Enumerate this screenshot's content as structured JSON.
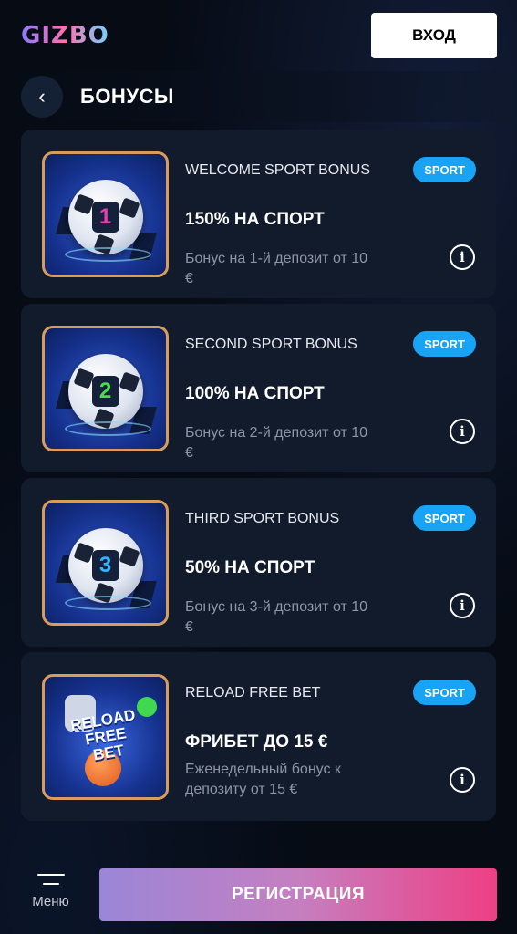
{
  "header": {
    "logo": "GIZBO",
    "login_label": "ВХОД"
  },
  "titlebar": {
    "back_icon": "chevron-left-icon",
    "title": "БОНУСЫ"
  },
  "bonuses": [
    {
      "name": "WELCOME SPORT BONUS",
      "badge": "SPORT",
      "headline": "150% НА СПОРТ",
      "description": "Бонус на 1-й депозит от 10 €",
      "ball_number": "1",
      "number_color": "#e83fb0"
    },
    {
      "name": "SECOND SPORT BONUS",
      "badge": "SPORT",
      "headline": "100% НА СПОРТ",
      "description": "Бонус на 2-й депозит от 10 €",
      "ball_number": "2",
      "number_color": "#44e04a"
    },
    {
      "name": "THIRD SPORT BONUS",
      "badge": "SPORT",
      "headline": "50% НА СПОРТ",
      "description": "Бонус на 3-й депозит от 10 €",
      "ball_number": "3",
      "number_color": "#31b6ff"
    },
    {
      "name": "RELOAD FREE BET",
      "badge": "SPORT",
      "headline": "ФРИБЕТ ДО 15 €",
      "description": "Еженедельный бонус к депозиту от 15 €",
      "art_text_line1": "RELOAD",
      "art_text_line2": "FREE BET"
    }
  ],
  "footer": {
    "menu_label": "Меню",
    "register_label": "РЕГИСТРАЦИЯ"
  },
  "colors": {
    "badge": "#19a3f5",
    "thumb_border": "#d99c5a",
    "card_bg": "#111b2b"
  }
}
